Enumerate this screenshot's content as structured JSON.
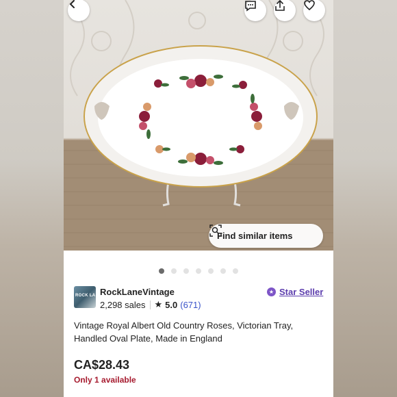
{
  "photo": {
    "alt_description_hidden": "",
    "find_similar_label": "Find similar items"
  },
  "toolbar": {
    "back_icon": "chevron-left-icon",
    "message_icon": "message-icon",
    "share_icon": "share-icon",
    "favorite_icon": "heart-icon"
  },
  "carousel": {
    "total_dots": 7,
    "active_index": 0
  },
  "seller": {
    "avatar_text": "ROCK LA",
    "name": "RockLaneVintage",
    "sales": "2,298 sales",
    "rating": "5.0",
    "reviews": "(671)",
    "badge": "Star Seller"
  },
  "listing": {
    "title": "Vintage Royal Albert Old Country Roses, Victorian Tray, Handled Oval Plate, Made in England",
    "price": "CA$28.43",
    "availability": "Only 1 available"
  },
  "colors": {
    "accent_purple": "#5c3dad",
    "review_blue": "#3a53c9",
    "stock_red": "#a61a2e"
  }
}
